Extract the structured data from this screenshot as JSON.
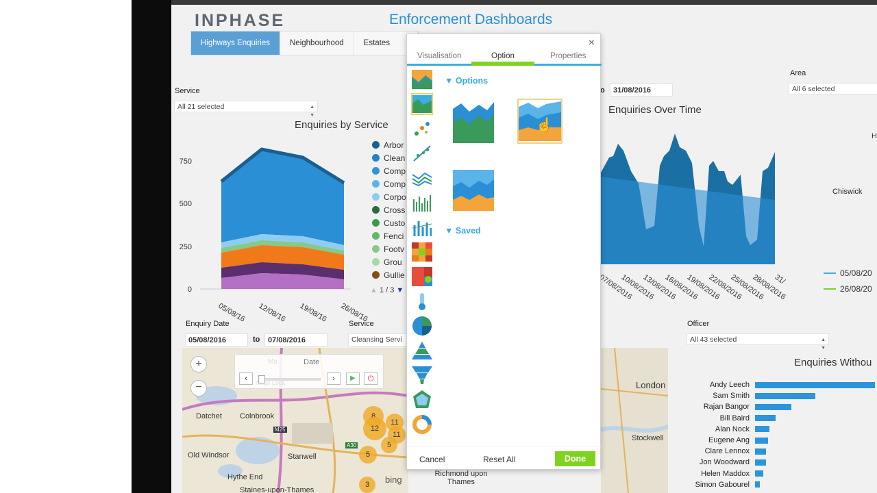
{
  "app": {
    "logo": "INPHASE",
    "title": "Enforcement Dashboards"
  },
  "tabs": [
    {
      "label": "Highways Enquiries",
      "active": true
    },
    {
      "label": "Neighbourhood",
      "active": false
    },
    {
      "label": "Estates",
      "active": false
    }
  ],
  "filters": {
    "service": {
      "label": "Service",
      "value": "All 21 selected"
    },
    "area": {
      "label": "Area",
      "value": "All 6 selected"
    },
    "date_to_top": {
      "to_fragment": "o",
      "value": "31/08/2016"
    },
    "enquiry_date": {
      "label": "Enquiry Date",
      "from": "05/08/2016",
      "to_label": "to",
      "to": "07/08/2016"
    },
    "service2": {
      "label": "Service",
      "value": "Cleansing Servi"
    },
    "officer": {
      "label": "Officer",
      "value": "All 43 selected"
    }
  },
  "enquiries_by_service": {
    "title": "Enquiries by Service",
    "y_ticks": [
      "750",
      "500",
      "250",
      "0"
    ],
    "x_ticks": [
      "05/08/16",
      "12/08/16",
      "19/08/16",
      "26/08/16"
    ],
    "legend": [
      {
        "label": "Arbor",
        "color": "#1a5f8f"
      },
      {
        "label": "Clean",
        "color": "#2383c4"
      },
      {
        "label": "Comp",
        "color": "#2b95dc"
      },
      {
        "label": "Comp",
        "color": "#5bb4e8"
      },
      {
        "label": "Corpo",
        "color": "#8fcdf0"
      },
      {
        "label": "Cross",
        "color": "#2e6b3a"
      },
      {
        "label": "Custo",
        "color": "#3e9a4b"
      },
      {
        "label": "Fenci",
        "color": "#62b868"
      },
      {
        "label": "Footv",
        "color": "#86c98a"
      },
      {
        "label": "Grou",
        "color": "#a8d8a8"
      },
      {
        "label": "Gullie",
        "color": "#8a4a14"
      }
    ],
    "pager": "1 / 3"
  },
  "enquiries_over_time": {
    "title": "Enquiries Over Time",
    "x_ticks": [
      "07/08/2016",
      "10/08/2016",
      "13/08/2016",
      "16/08/2016",
      "19/08/2016",
      "22/08/2016",
      "25/08/2016",
      "28/08/2016",
      "31/"
    ],
    "side_label": "Chiswick",
    "side_letter": "H",
    "legend": [
      {
        "label": "05/08/20",
        "color": "#3aaee0"
      },
      {
        "label": "26/08/20",
        "color": "#7ed321"
      }
    ]
  },
  "map": {
    "timeline_label": "Date",
    "timeline_faded": [
      "Ma",
      "hings Lock"
    ],
    "places": [
      "Datchet",
      "Colnbrook",
      "Old Windsor",
      "Stanwell",
      "Hythe End",
      "Staines-upon-Thames",
      "London",
      "Stockwell",
      "Richmond upon Thames"
    ],
    "roads": [
      "M25",
      "A30"
    ],
    "clusters": [
      "8",
      "11",
      "12",
      "11",
      "5",
      "5",
      "3"
    ],
    "attribution": "bing"
  },
  "enquiries_without": {
    "title": "Enquiries Withou",
    "officers": [
      {
        "name": "Andy Leech",
        "value": 100
      },
      {
        "name": "Sam Smith",
        "value": 50
      },
      {
        "name": "Rajan Bangor",
        "value": 30
      },
      {
        "name": "Bill Baird",
        "value": 17
      },
      {
        "name": "Alan Nock",
        "value": 12
      },
      {
        "name": "Eugene Ang",
        "value": 11
      },
      {
        "name": "Clare Lennox",
        "value": 9
      },
      {
        "name": "Jon Woodward",
        "value": 9
      },
      {
        "name": "Helen Maddox",
        "value": 7
      },
      {
        "name": "Simon Gabourel",
        "value": 4
      }
    ]
  },
  "dialog": {
    "tabs": [
      "Visualisation",
      "Option",
      "Properties"
    ],
    "active_tab": "Option",
    "options_heading": "Options",
    "saved_heading": "Saved",
    "buttons": {
      "cancel": "Cancel",
      "reset": "Reset All",
      "done": "Done"
    },
    "side_icons": [
      "line-area-icon",
      "area-icon",
      "scatter-icon",
      "trend-scatter-icon",
      "multi-line-icon",
      "sparkline-icon",
      "bar-lines-icon",
      "heatmap-icon",
      "treemap-icon",
      "thermometer-icon",
      "pie-icon",
      "pyramid-icon",
      "funnel-icon",
      "radar-icon",
      "donut-icon"
    ],
    "thumbnails": [
      "stacked-area-option",
      "stream-area-option",
      "percent-area-option"
    ],
    "selected_thumbnail": 1
  }
}
